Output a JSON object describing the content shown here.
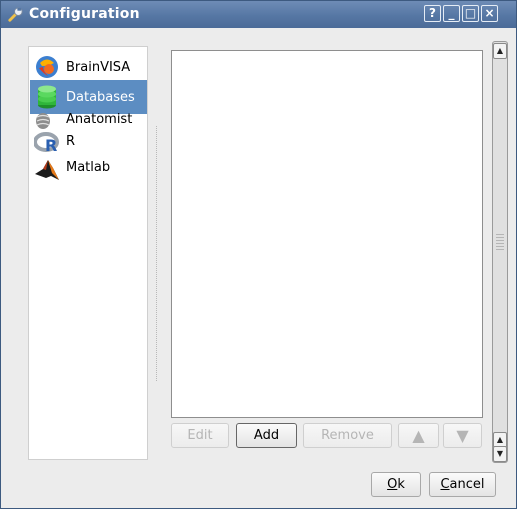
{
  "window": {
    "title": "Configuration",
    "controls": {
      "help": "?",
      "minimize": "_",
      "maximize": "□",
      "close": "×"
    }
  },
  "sidebar": {
    "items": [
      {
        "label": "BrainVISA",
        "icon": "brainvisa-icon",
        "selected": false
      },
      {
        "label": "Databases",
        "icon": "database-icon",
        "selected": true
      },
      {
        "label": "Anatomist",
        "icon": "anatomist-icon",
        "selected": false
      },
      {
        "label": "R",
        "icon": "r-icon",
        "selected": false
      },
      {
        "label": "Matlab",
        "icon": "matlab-icon",
        "selected": false
      }
    ]
  },
  "databases_panel": {
    "items": [],
    "buttons": {
      "edit": "Edit",
      "add": "Add",
      "remove": "Remove",
      "move_up": "▲",
      "move_down": "▼"
    }
  },
  "dialog_buttons": {
    "ok_accel": "O",
    "ok_rest": "k",
    "cancel_accel": "C",
    "cancel_rest": "ancel"
  },
  "colors": {
    "titlebar": "#5677a4",
    "selection": "#5c8dc2",
    "window_bg": "#ececec"
  }
}
